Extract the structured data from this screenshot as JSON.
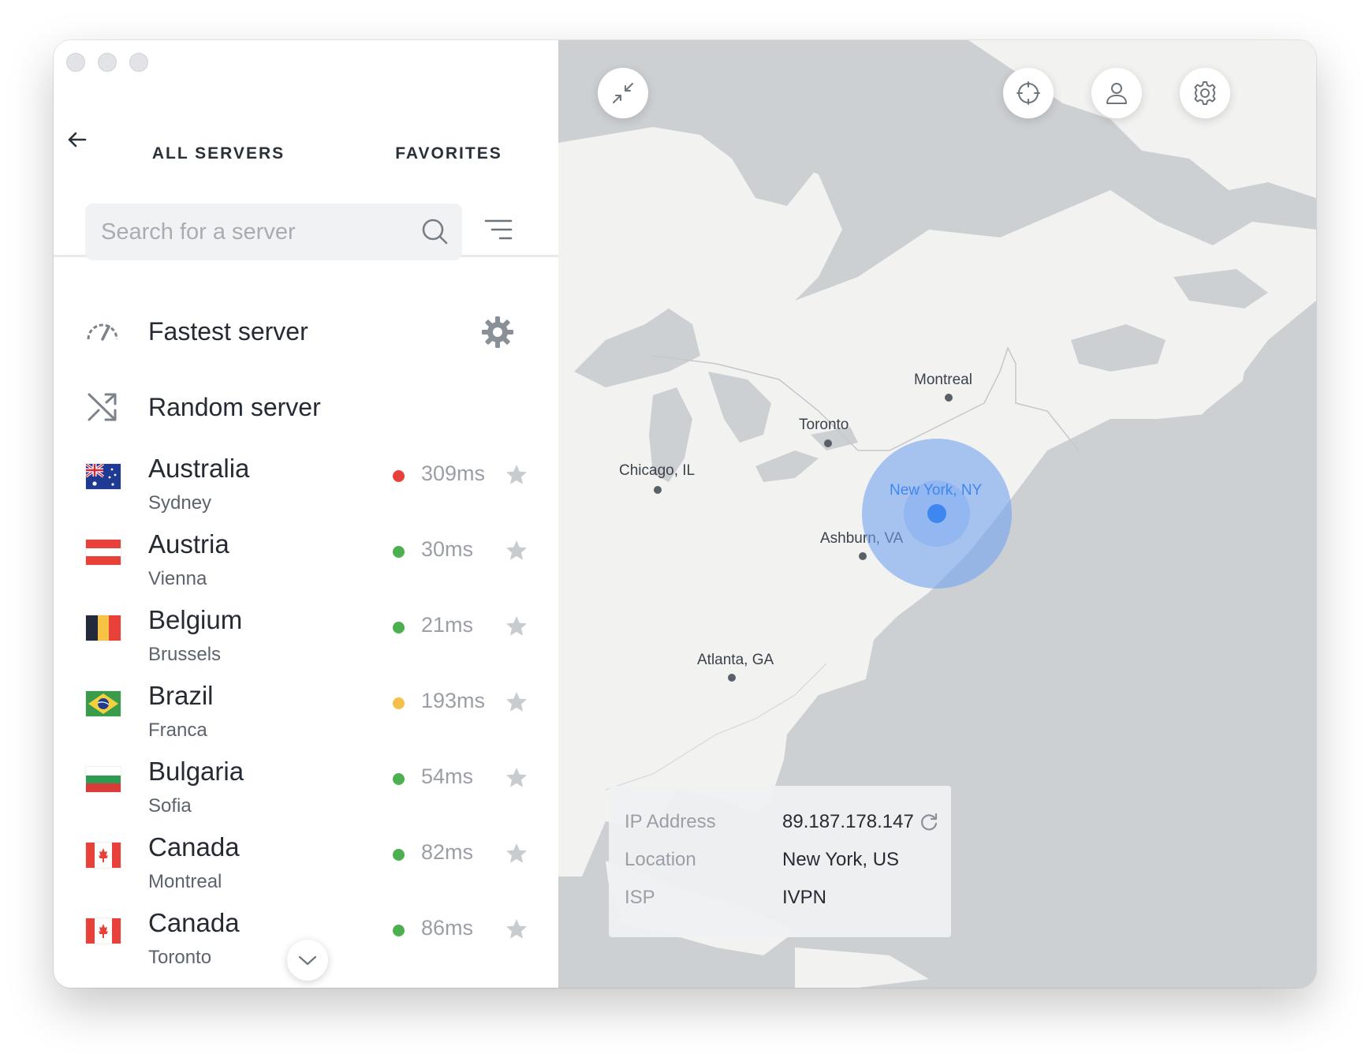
{
  "tabs": {
    "all": "ALL SERVERS",
    "favorites": "FAVORITES"
  },
  "search": {
    "placeholder": "Search for a server"
  },
  "special": {
    "fastest": "Fastest server",
    "random": "Random server"
  },
  "servers": [
    {
      "country": "Australia",
      "city": "Sydney",
      "ping": "309ms",
      "status_color": "#e8413a",
      "flag": "australia-flag"
    },
    {
      "country": "Austria",
      "city": "Vienna",
      "ping": "30ms",
      "status_color": "#4caf50",
      "flag": "austria-flag"
    },
    {
      "country": "Belgium",
      "city": "Brussels",
      "ping": "21ms",
      "status_color": "#4caf50",
      "flag": "belgium-flag"
    },
    {
      "country": "Brazil",
      "city": "Franca",
      "ping": "193ms",
      "status_color": "#f4c04a",
      "flag": "brazil-flag"
    },
    {
      "country": "Bulgaria",
      "city": "Sofia",
      "ping": "54ms",
      "status_color": "#4caf50",
      "flag": "bulgaria-flag"
    },
    {
      "country": "Canada",
      "city": "Montreal",
      "ping": "82ms",
      "status_color": "#4caf50",
      "flag": "canada-flag"
    },
    {
      "country": "Canada",
      "city": "Toronto",
      "ping": "86ms",
      "status_color": "#4caf50",
      "flag": "canada-flag"
    }
  ],
  "map": {
    "cities": [
      {
        "name": "Montreal"
      },
      {
        "name": "Toronto"
      },
      {
        "name": "Chicago, IL"
      },
      {
        "name": "Ashburn, VA"
      },
      {
        "name": "Atlanta, GA"
      }
    ],
    "selected": "New York, NY"
  },
  "info": {
    "ip_label": "IP Address",
    "ip_value": "89.187.178.147",
    "location_label": "Location",
    "location_value": "New York, US",
    "isp_label": "ISP",
    "isp_value": "IVPN"
  },
  "colors": {
    "accent": "#3f87de",
    "green": "#4caf50",
    "red": "#e8413a",
    "yellow": "#f4c04a"
  }
}
